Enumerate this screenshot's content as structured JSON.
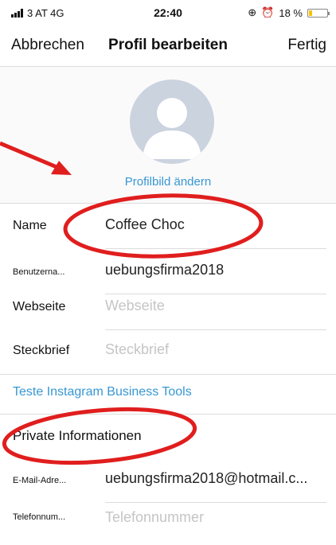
{
  "status": {
    "carrier": "3 AT  4G",
    "time": "22:40",
    "battery": "18 %",
    "battery_level": 0.18
  },
  "navbar": {
    "cancel_label": "Abbrechen",
    "title": "Profil bearbeiten",
    "done_label": "Fertig"
  },
  "profile": {
    "change_photo_label": "Profilbild ändern"
  },
  "fields": {
    "name": {
      "label": "Name",
      "value": "Coffee Choc"
    },
    "username": {
      "label": "Benutzerna...",
      "value": "uebungsfirma2018"
    },
    "website": {
      "label": "Webseite",
      "placeholder": "Webseite"
    },
    "bio": {
      "label": "Steckbrief",
      "placeholder": "Steckbrief"
    }
  },
  "business_tools_label": "Teste Instagram Business Tools",
  "private": {
    "title": "Private Informationen",
    "email": {
      "label": "E-Mail-Adre...",
      "value": "uebungsfirma2018@hotmail.c..."
    },
    "phone": {
      "label": "Telefonnum...",
      "placeholder": "Telefonnummer"
    }
  },
  "colors": {
    "link_blue": "#3797d3",
    "annotation_red": "#e01e1e",
    "separator": "#dcdcdc",
    "avatar_bg": "#cbd3df"
  }
}
